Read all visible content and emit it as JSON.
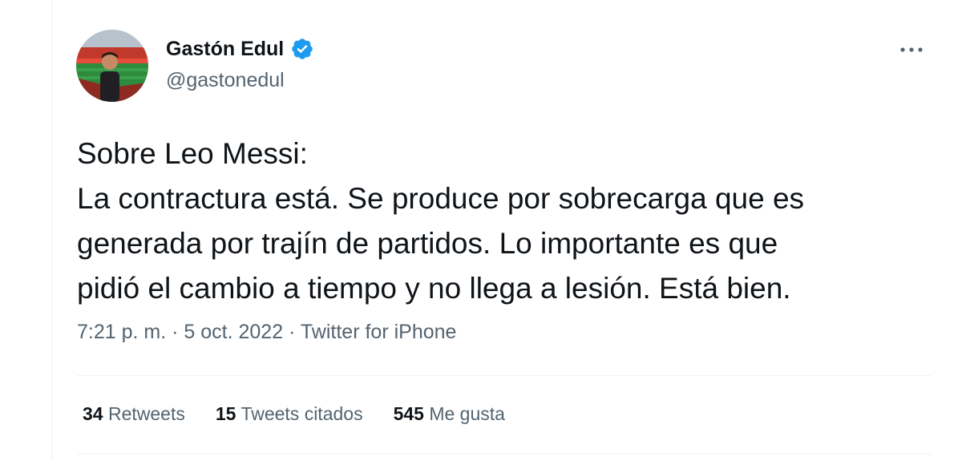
{
  "author": {
    "display_name": "Gastón Edul",
    "handle": "@gastonedul",
    "verified_color": "#1d9bf0",
    "avatar_icon": "profile-photo"
  },
  "more_icon": "more-horizontal-icon",
  "tweet": {
    "lines": [
      "Sobre Leo Messi:",
      "La contractura está. Se produce por sobrecarga que es",
      "generada por trajín de partidos. Lo importante es que",
      "pidió el cambio a tiempo y no llega a lesión. Está bien."
    ]
  },
  "meta": {
    "time": "7:21 p. m.",
    "separator": "·",
    "date": "5 oct. 2022",
    "source": "Twitter for iPhone"
  },
  "stats": {
    "retweets": {
      "count": "34",
      "label": "Retweets"
    },
    "quotes": {
      "count": "15",
      "label": "Tweets citados"
    },
    "likes": {
      "count": "545",
      "label": "Me gusta"
    }
  }
}
